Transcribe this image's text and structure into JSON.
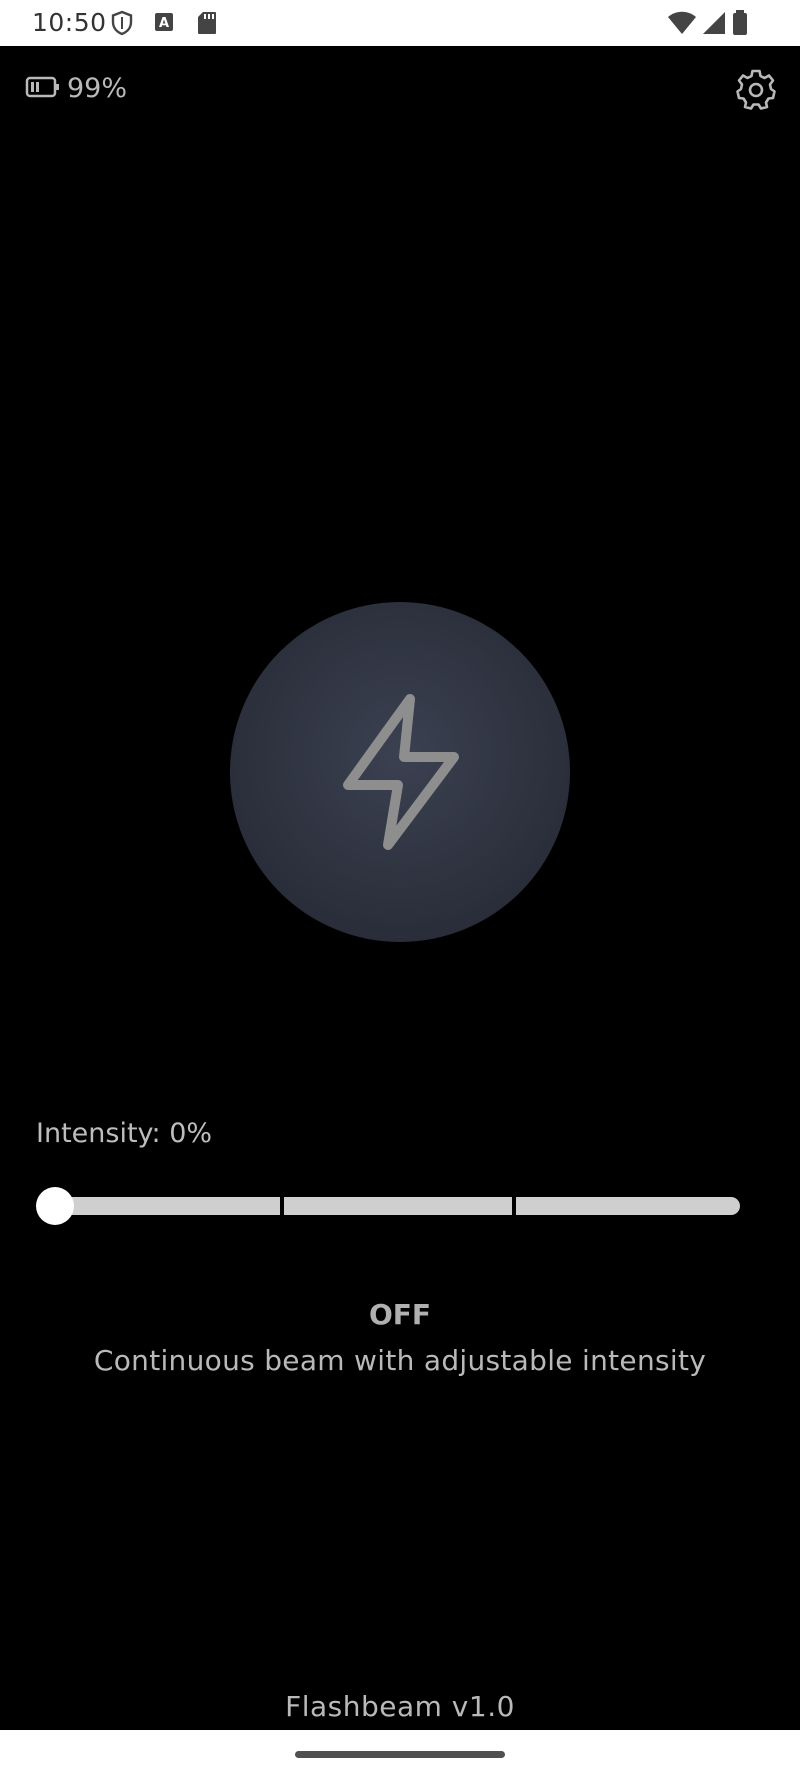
{
  "status_bar": {
    "time": "10:50",
    "left_icons": [
      "shield-icon",
      "a-badge-icon",
      "sd-card-icon"
    ],
    "right_icons": [
      "wifi-icon",
      "cell-signal-icon",
      "battery-full-icon"
    ]
  },
  "header": {
    "battery_percent": "99%",
    "battery_icon": "battery-low-icon",
    "settings_icon": "gear-icon"
  },
  "power_button": {
    "icon": "lightning-bolt-icon",
    "color": "#2e3240"
  },
  "intensity": {
    "label": "Intensity: 0%",
    "value": 0,
    "steps": 4
  },
  "status": {
    "state": "OFF",
    "description": "Continuous beam with adjustable intensity"
  },
  "footer": {
    "version": "Flashbeam v1.0"
  },
  "colors": {
    "background": "#000000",
    "text": "#b9b9b9",
    "track": "#cfcfcf",
    "thumb": "#ffffff"
  }
}
